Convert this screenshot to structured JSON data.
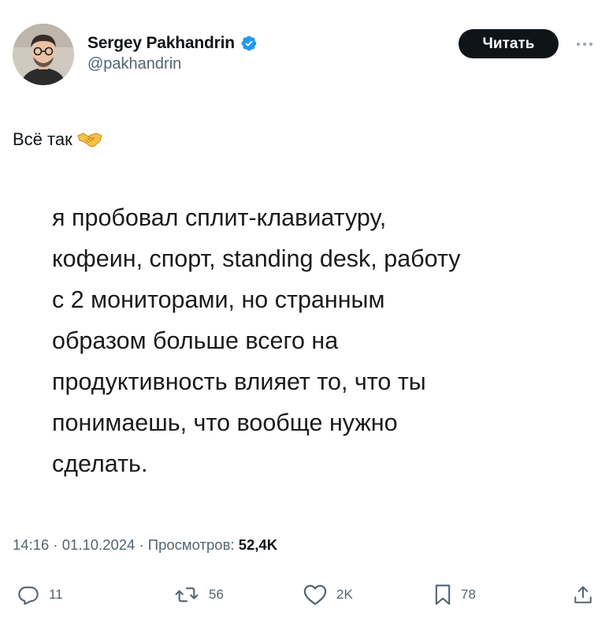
{
  "author": {
    "name": "Sergey Pakhandrin",
    "handle": "@pakhandrin",
    "verified": true,
    "avatar_icon": "person-photo-avatar"
  },
  "header": {
    "follow_label": "Читать",
    "more_icon": "more-horizontal-icon"
  },
  "tweet": {
    "text": "Всё так",
    "emoji_icon": "handshake-icon"
  },
  "media": {
    "text": "я пробовал сплит-клавиатуру,\nкофеин, спорт, standing desk, работу\nс 2 мониторами, но странным\nобразом больше всего на\nпродуктивность влияет то, что ты\nпонимаешь, что вообще нужно\nсделать."
  },
  "meta": {
    "time": "14:16",
    "separator": " · ",
    "date": "01.10.2024",
    "views_label": "Просмотров:",
    "views_count": "52,4K"
  },
  "actions": {
    "replies": "11",
    "reposts": "56",
    "likes": "2K",
    "bookmarks": "78"
  },
  "colors": {
    "verified": "#1d9bf0",
    "button_bg": "#0f1419",
    "muted_text": "#536471"
  }
}
